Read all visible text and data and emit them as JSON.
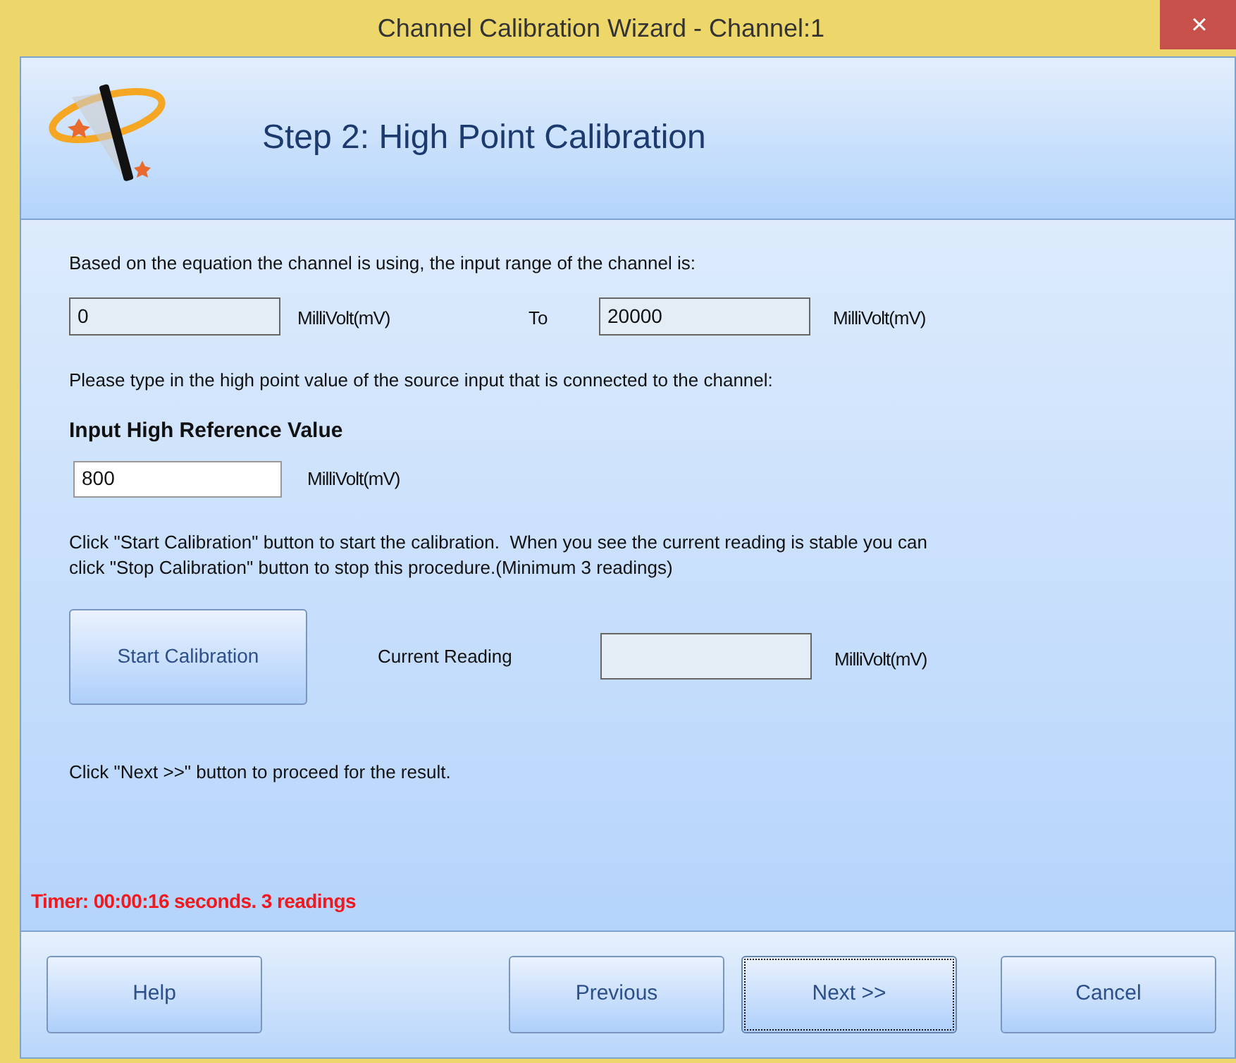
{
  "window": {
    "title": "Channel Calibration Wizard - Channel:1",
    "close": "×"
  },
  "header": {
    "title": "Step 2: High Point Calibration"
  },
  "range": {
    "intro": "Based on the equation the channel is using, the input range of the channel is:",
    "from": {
      "value": "0",
      "readonly": true
    },
    "from_unit": "MilliVolt(mV)",
    "to_label": "To",
    "to": {
      "value": "20000",
      "readonly": true
    },
    "to_unit": "MilliVolt(mV)"
  },
  "reference": {
    "intro": "Please type in the high point value of the source input that is connected to the channel:",
    "label": "Input High Reference Value",
    "field": {
      "value": "800",
      "readonly": false
    },
    "unit": "MilliVolt(mV)"
  },
  "calibration": {
    "instructions": "Click \"Start Calibration\" button to start the calibration.  When you see the current reading is stable you can\nclick \"Stop Calibration\" button to stop this procedure.(Minimum 3 readings)",
    "button": "Start Calibration",
    "reading_label": "Current Reading",
    "reading": {
      "readonly": true
    },
    "unit": "MilliVolt(mV)"
  },
  "next_hint": "Click \"Next >>\" button to proceed for the result.",
  "timer": "Timer: 00:00:16 seconds. 3 readings",
  "buttons": [
    {
      "label": "Help",
      "focused": false
    },
    {
      "label": "Previous",
      "focused": false
    },
    {
      "label": "Next >>",
      "focused": true
    },
    {
      "label": "Cancel",
      "focused": false
    }
  ]
}
